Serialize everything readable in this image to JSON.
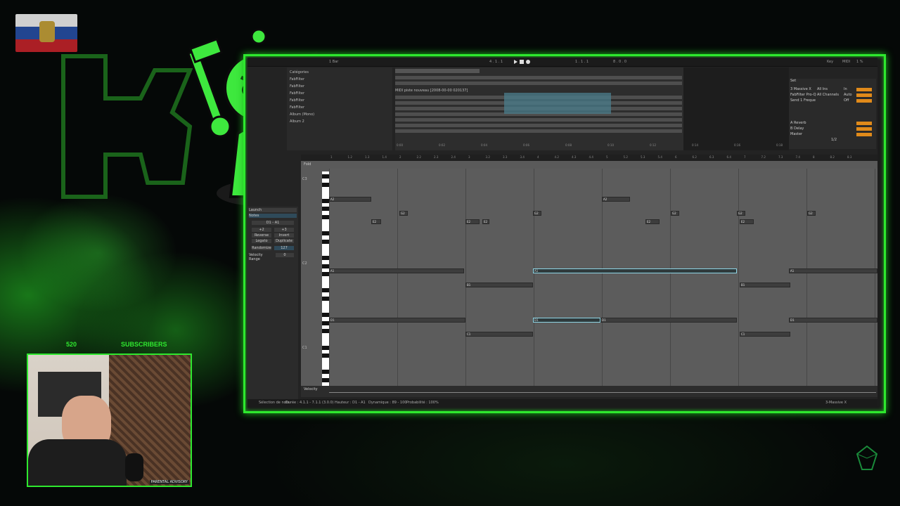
{
  "overlay": {
    "subscriber_count": "520",
    "subscriber_label": "SUBSCRIBERS"
  },
  "daw": {
    "topbar": {
      "bar_setting": "1 Bar",
      "position": "4 . 1 . 1",
      "loop_start": "1 . 1 . 1",
      "loop_length": "8 . 0 . 0",
      "key_label": "Key",
      "midi_label": "MIDI",
      "cpu": "1 %"
    },
    "clip": {
      "title": "MIDI piste nouveau [2008-00-00 020137]",
      "timeline_marks": [
        "0:00",
        "0:02",
        "0:04",
        "0:06",
        "0:08",
        "0:10",
        "0:12",
        "0:14",
        "0:16",
        "0:18"
      ]
    },
    "browser": {
      "items": [
        "Catégories",
        "FabFilter",
        "FabFilter",
        "FabFilter",
        "FabFilter",
        "FabFilter",
        "Album (Mono)",
        "Album 2"
      ]
    },
    "mixer": {
      "set_label": "Set",
      "tracks": [
        {
          "name": "3 Massive X",
          "input": "All Ins",
          "channel": "All Channels",
          "monitor": "In"
        },
        {
          "name": "FabFilter Pro-Q",
          "input": "",
          "channel": "",
          "monitor": "Auto"
        },
        {
          "name": "Send 1 Freque",
          "input": "",
          "channel": "",
          "monitor": "Off"
        }
      ],
      "returns": [
        "A Reverb",
        "B Delay",
        "Master"
      ],
      "master_ratio": "1/2"
    },
    "left_panel": {
      "section_launch": "Launch",
      "section_notes": "Notes",
      "range": "D1 - A1",
      "transpose_up": "+2",
      "transpose_down": "+3",
      "reverse": "Reverse",
      "invert": "Invert",
      "legato": "Legato",
      "duplicate": "Duplicate",
      "randomize": "Randomize",
      "randomize_value": "127",
      "velocity_range_label": "Velocity Range",
      "velocity_range_value": "0"
    },
    "editor": {
      "fold_label": "Fold",
      "velocity_label": "Velocity",
      "octave_labels": [
        "C3",
        "C2",
        "C1"
      ],
      "ruler": [
        "1",
        "1.2",
        "1.3",
        "1.4",
        "2",
        "2.2",
        "2.3",
        "2.4",
        "3",
        "3.2",
        "3.3",
        "3.4",
        "4",
        "4.2",
        "4.3",
        "4.4",
        "5",
        "5.2",
        "5.3",
        "5.4",
        "6",
        "6.2",
        "6.3",
        "6.4",
        "7",
        "7.2",
        "7.3",
        "7.4",
        "8",
        "8.2",
        "8.3"
      ]
    },
    "status": {
      "selection": "Sélection de note",
      "duration": "Durée : 4.1.1 - 7.1.1 (3.0.0)",
      "pitch": "Hauteur : D1 - A1",
      "dynamics": "Dynamique : 89 - 100",
      "probability": "Probabilité : 100%",
      "track": "3-Massive X"
    }
  },
  "webcam": {
    "badge": "PARENTAL ADVISORY"
  },
  "colors": {
    "neon_green": "#2ee82e",
    "daw_bg": "#232323",
    "selected_note": "#8fd6e6"
  }
}
